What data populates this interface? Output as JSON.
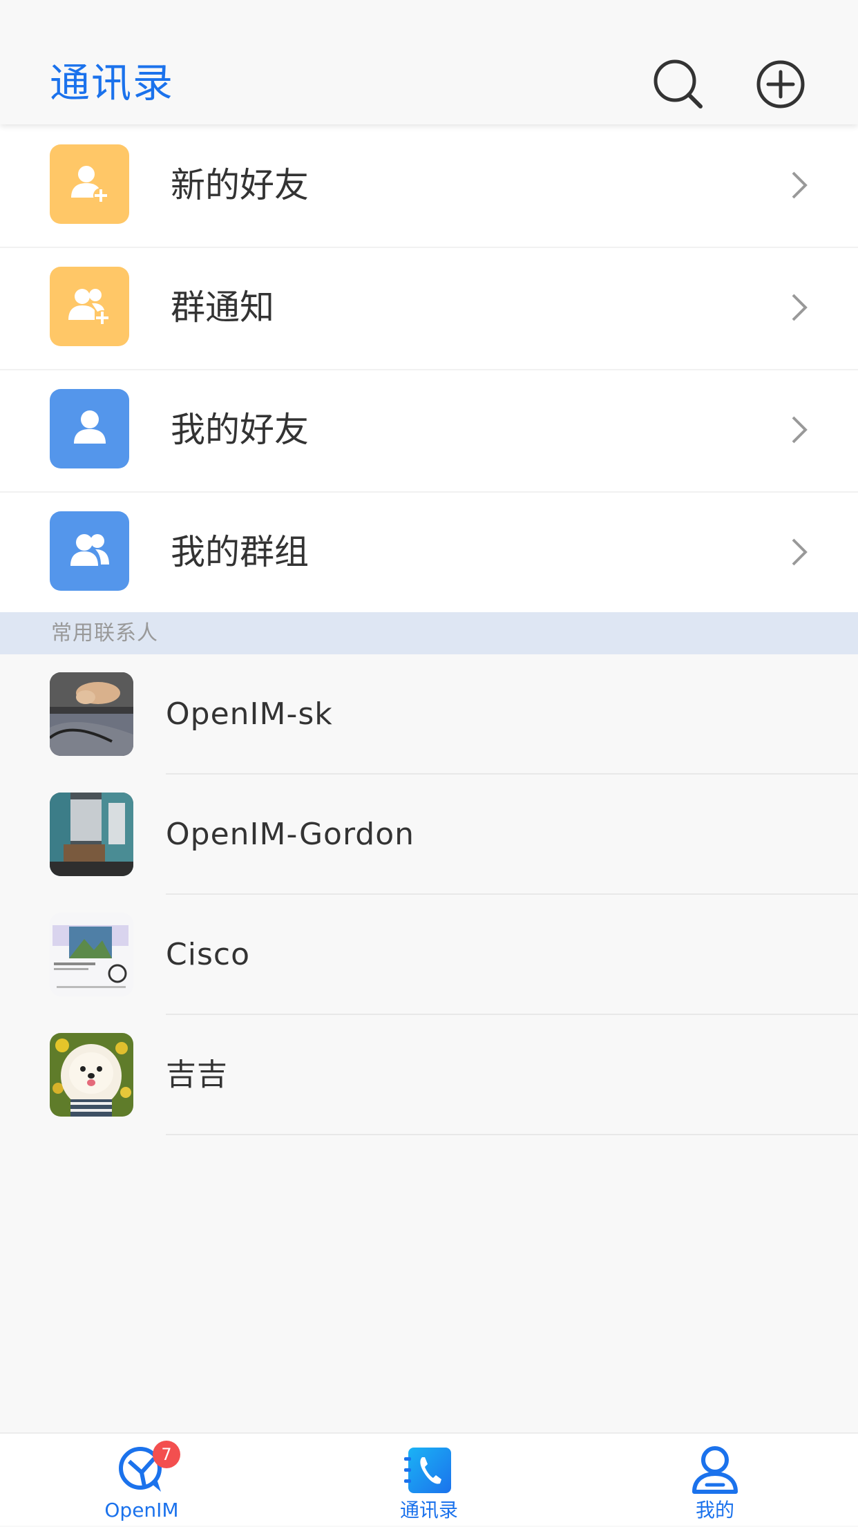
{
  "header": {
    "title": "通讯录",
    "search_icon": "search-icon",
    "add_icon": "add-circle-icon",
    "title_color": "#1b72ec"
  },
  "menu": {
    "items": [
      {
        "label": "新的好友",
        "icon": "user-add-icon",
        "icon_color": "#ffc767"
      },
      {
        "label": "群通知",
        "icon": "group-add-icon",
        "icon_color": "#ffc767"
      },
      {
        "label": "我的好友",
        "icon": "user-icon",
        "icon_color": "#5496eb"
      },
      {
        "label": "我的群组",
        "icon": "group-icon",
        "icon_color": "#5496eb"
      }
    ]
  },
  "section": {
    "frequent_contacts": "常用联系人"
  },
  "contacts": [
    {
      "name": "OpenIM-sk"
    },
    {
      "name": "OpenIM-Gordon"
    },
    {
      "name": "Cisco"
    },
    {
      "name": "吉吉"
    }
  ],
  "tabbar": {
    "tabs": [
      {
        "label": "OpenIM",
        "icon": "openim-chat-icon",
        "badge": "7"
      },
      {
        "label": "通讯录",
        "icon": "contacts-phone-icon"
      },
      {
        "label": "我的",
        "icon": "profile-icon"
      }
    ],
    "accent_color": "#1b72ec",
    "badge_color": "#f34f4f"
  }
}
